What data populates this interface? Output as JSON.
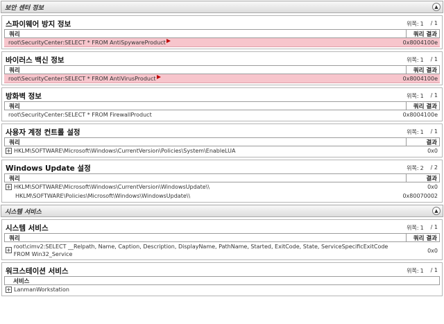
{
  "categories": {
    "security": {
      "label": "보안 센터 정보",
      "icon": "collapse-icon"
    },
    "services": {
      "label": "시스템 서비스",
      "icon": "collapse-icon"
    }
  },
  "pager_label": "위쪽:",
  "sections": {
    "antispyware": {
      "title": "스파이웨어 방지 정보",
      "page": "1",
      "total": "/ 1",
      "col1": "쿼리",
      "col2": "쿼리 결과",
      "rows": [
        {
          "query": "root\\SecurityCenter:SELECT * FROM AntiSpywareProduct",
          "result": "0x8004100e",
          "status": "error"
        }
      ]
    },
    "antivirus": {
      "title": "바이러스 백신 정보",
      "page": "1",
      "total": "/ 1",
      "col1": "쿼리",
      "col2": "쿼리 결과",
      "rows": [
        {
          "query": "root\\SecurityCenter:SELECT * FROM AntiVirusProduct",
          "result": "0x8004100e",
          "status": "error"
        }
      ]
    },
    "firewall": {
      "title": "방화벽 정보",
      "page": "1",
      "total": "/ 1",
      "col1": "쿼리",
      "col2": "쿼리 결과",
      "rows": [
        {
          "query": "root\\SecurityCenter:SELECT * FROM FirewallProduct",
          "result": "0x8004100e"
        }
      ]
    },
    "uac": {
      "title": "사용자 계정 컨트롤 설정",
      "page": "1",
      "total": "/ 1",
      "col1": "쿼리",
      "col2": "결과",
      "rows": [
        {
          "query": "HKLM\\SOFTWARE\\Microsoft\\Windows\\CurrentVersion\\Policies\\System\\EnableLUA",
          "result": "0x0"
        }
      ]
    },
    "wu": {
      "title": "Windows Update 설정",
      "page": "2",
      "total": "/ 2",
      "col1": "쿼리",
      "col2": "결과",
      "rows": [
        {
          "query": "HKLM\\SOFTWARE\\Microsoft\\Windows\\CurrentVersion\\WindowsUpdate\\\\",
          "result": "0x0"
        },
        {
          "query": "HKLM\\SOFTWARE\\Policies\\Microsoft\\Windows\\WindowsUpdate\\\\",
          "result": "0x80070002"
        }
      ]
    },
    "sysservices": {
      "title": "시스템 서비스",
      "page": "1",
      "total": "/ 1",
      "col1": "쿼리",
      "col2": "쿼리 결과",
      "rows": [
        {
          "query": "root\\cimv2:SELECT __Relpath, Name, Caption, Description, DisplayName, PathName, Started, ExitCode, State, ServiceSpecificExitCode FROM Win32_Service",
          "result": "0x0"
        }
      ]
    },
    "workstation": {
      "title": "워크스테이션 서비스",
      "page": "1",
      "total": "/ 1",
      "col1": "서비스",
      "rows": [
        {
          "query": "LanmanWorkstation"
        }
      ]
    }
  },
  "colors": {
    "error_row": "#f7c5cc",
    "error_flag": "#c00000"
  }
}
